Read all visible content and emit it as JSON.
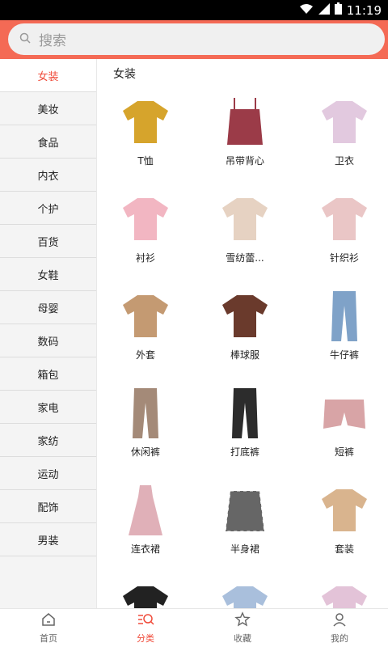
{
  "status": {
    "time": "11:19"
  },
  "search": {
    "placeholder": "搜索"
  },
  "sidebar": {
    "items": [
      {
        "label": "女装",
        "active": true
      },
      {
        "label": "美妆"
      },
      {
        "label": "食品"
      },
      {
        "label": "内衣"
      },
      {
        "label": "个护"
      },
      {
        "label": "百货"
      },
      {
        "label": "女鞋"
      },
      {
        "label": "母婴"
      },
      {
        "label": "数码"
      },
      {
        "label": "箱包"
      },
      {
        "label": "家电"
      },
      {
        "label": "家纺"
      },
      {
        "label": "运动"
      },
      {
        "label": "配饰"
      },
      {
        "label": "男装"
      }
    ]
  },
  "main": {
    "title": "女装",
    "products": [
      {
        "label": "T恤",
        "icon": "tshirt-icon",
        "color": "#d6a42c"
      },
      {
        "label": "吊带背心",
        "icon": "camisole-icon",
        "color": "#9b3b48"
      },
      {
        "label": "卫衣",
        "icon": "sweatshirt-icon",
        "color": "#e2c9df"
      },
      {
        "label": "衬衫",
        "icon": "shirt-icon",
        "color": "#f2b6c2"
      },
      {
        "label": "雪纺蕾...",
        "icon": "chiffon-blouse-icon",
        "color": "#e6d2c2"
      },
      {
        "label": "针织衫",
        "icon": "cardigan-icon",
        "color": "#eac6c6"
      },
      {
        "label": "外套",
        "icon": "coat-icon",
        "color": "#c49a72"
      },
      {
        "label": "棒球服",
        "icon": "bomber-jacket-icon",
        "color": "#6a3a2c"
      },
      {
        "label": "牛仔裤",
        "icon": "jeans-icon",
        "color": "#7fa2c8"
      },
      {
        "label": "休闲裤",
        "icon": "casual-pants-icon",
        "color": "#a48a78"
      },
      {
        "label": "打底裤",
        "icon": "leggings-icon",
        "color": "#2c2c2c"
      },
      {
        "label": "短裤",
        "icon": "shorts-icon",
        "color": "#d8a4a6"
      },
      {
        "label": "连衣裙",
        "icon": "dress-icon",
        "color": "#e0b0b8"
      },
      {
        "label": "半身裙",
        "icon": "skirt-icon",
        "color": "#666666"
      },
      {
        "label": "套装",
        "icon": "set-icon",
        "color": "#d9b48e"
      },
      {
        "label": "",
        "icon": "tshirt-set-icon",
        "color": "#222222"
      },
      {
        "label": "",
        "icon": "blouse-icon",
        "color": "#a9bfdc"
      },
      {
        "label": "",
        "icon": "floral-top-icon",
        "color": "#e3c3d8"
      }
    ]
  },
  "tabbar": {
    "items": [
      {
        "label": "首页",
        "icon": "home-icon"
      },
      {
        "label": "分类",
        "icon": "category-search-icon",
        "active": true
      },
      {
        "label": "收藏",
        "icon": "star-icon"
      },
      {
        "label": "我的",
        "icon": "user-icon"
      }
    ]
  },
  "colors": {
    "accent": "#f46a55",
    "active_text": "#f04b3a"
  }
}
